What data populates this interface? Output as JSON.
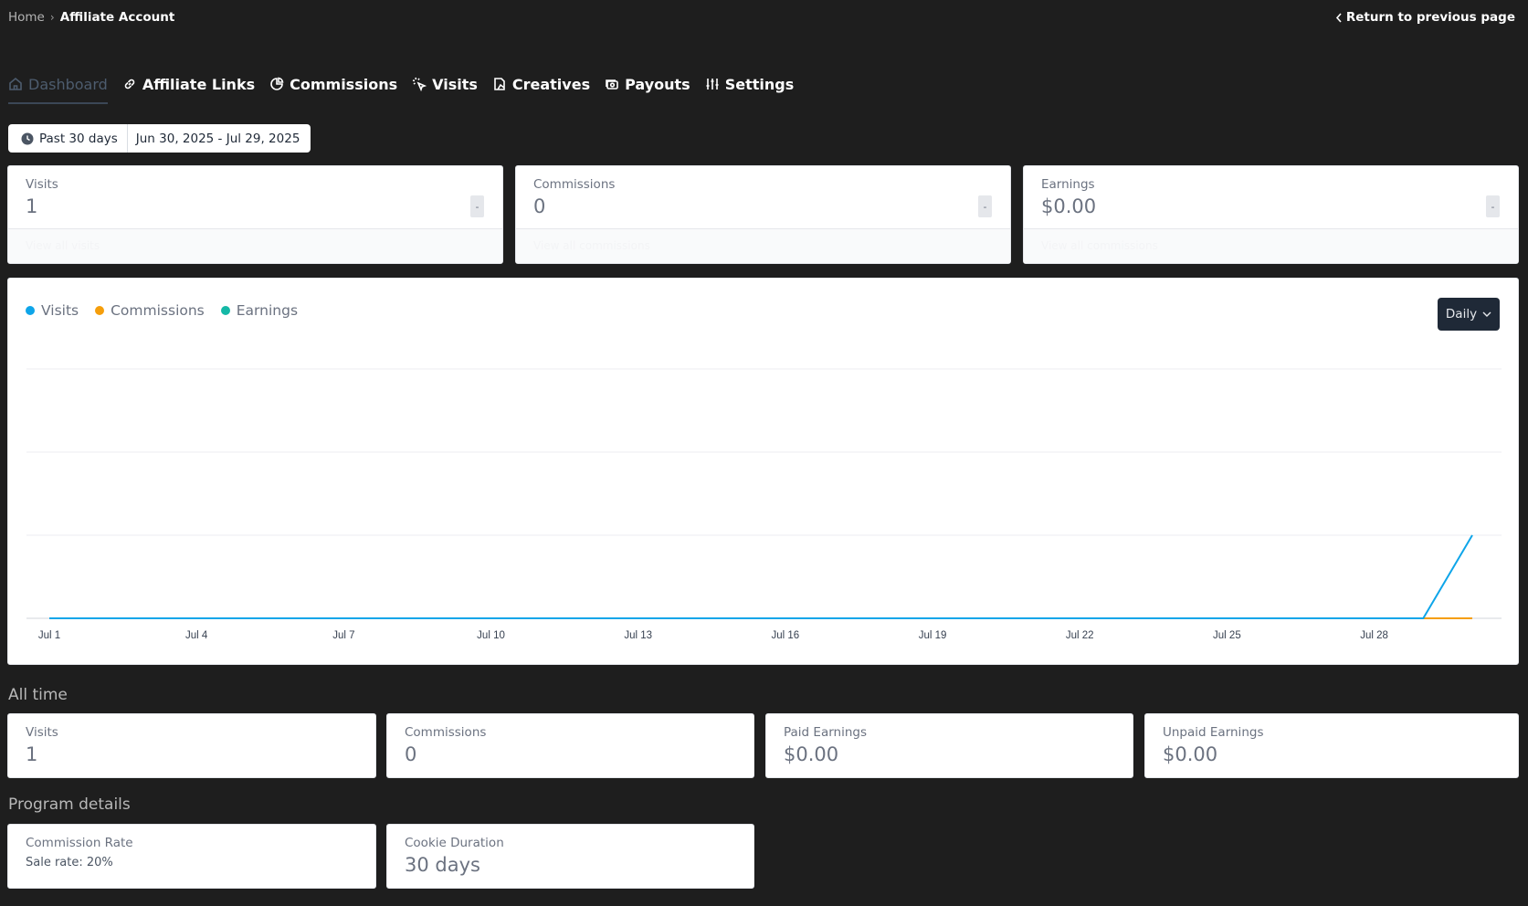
{
  "breadcrumb": {
    "home": "Home",
    "separator": "›",
    "current": "Affiliate Account"
  },
  "return_link": {
    "label": "Return to previous page",
    "icon": "chevron-left-icon"
  },
  "tabs": [
    {
      "label": "Dashboard",
      "icon": "home-icon",
      "active": true
    },
    {
      "label": "Affiliate Links",
      "icon": "link-icon",
      "active": false
    },
    {
      "label": "Commissions",
      "icon": "pie-chart-icon",
      "active": false
    },
    {
      "label": "Visits",
      "icon": "cursor-click-icon",
      "active": false
    },
    {
      "label": "Creatives",
      "icon": "image-icon",
      "active": false
    },
    {
      "label": "Payouts",
      "icon": "money-icon",
      "active": false
    },
    {
      "label": "Settings",
      "icon": "sliders-icon",
      "active": false
    }
  ],
  "date_range": {
    "preset": "Past 30 days",
    "value": "Jun 30, 2025 - Jul 29, 2025"
  },
  "period_stats": [
    {
      "label": "Visits",
      "value": "1",
      "trend": "-",
      "footer_link": "View all visits"
    },
    {
      "label": "Commissions",
      "value": "0",
      "trend": "-",
      "footer_link": "View all commissions"
    },
    {
      "label": "Earnings",
      "value": "$0.00",
      "trend": "-",
      "footer_link": "View all commissions"
    }
  ],
  "chart": {
    "interval": "Daily",
    "colors": {
      "visits": "#0ea5e9",
      "commissions": "#f59e0b",
      "earnings": "#14b8a6"
    }
  },
  "chart_data": {
    "type": "line",
    "x": [
      "Jul 1",
      "Jul 2",
      "Jul 3",
      "Jul 4",
      "Jul 5",
      "Jul 6",
      "Jul 7",
      "Jul 8",
      "Jul 9",
      "Jul 10",
      "Jul 11",
      "Jul 12",
      "Jul 13",
      "Jul 14",
      "Jul 15",
      "Jul 16",
      "Jul 17",
      "Jul 18",
      "Jul 19",
      "Jul 20",
      "Jul 21",
      "Jul 22",
      "Jul 23",
      "Jul 24",
      "Jul 25",
      "Jul 26",
      "Jul 27",
      "Jul 28",
      "Jul 29",
      "Jul 30"
    ],
    "x_tick_labels": [
      "Jul 1",
      "Jul 4",
      "Jul 7",
      "Jul 10",
      "Jul 13",
      "Jul 16",
      "Jul 19",
      "Jul 22",
      "Jul 25",
      "Jul 28"
    ],
    "series": [
      {
        "name": "Visits",
        "color": "#0ea5e9",
        "values": [
          0,
          0,
          0,
          0,
          0,
          0,
          0,
          0,
          0,
          0,
          0,
          0,
          0,
          0,
          0,
          0,
          0,
          0,
          0,
          0,
          0,
          0,
          0,
          0,
          0,
          0,
          0,
          0,
          0,
          1
        ]
      },
      {
        "name": "Commissions",
        "color": "#f59e0b",
        "values": [
          0,
          0,
          0,
          0,
          0,
          0,
          0,
          0,
          0,
          0,
          0,
          0,
          0,
          0,
          0,
          0,
          0,
          0,
          0,
          0,
          0,
          0,
          0,
          0,
          0,
          0,
          0,
          0,
          0,
          0
        ]
      },
      {
        "name": "Earnings",
        "color": "#14b8a6",
        "values": [
          0,
          0,
          0,
          0,
          0,
          0,
          0,
          0,
          0,
          0,
          0,
          0,
          0,
          0,
          0,
          0,
          0,
          0,
          0,
          0,
          0,
          0,
          0,
          0,
          0,
          0,
          0,
          0,
          0,
          0
        ]
      }
    ],
    "ylim": [
      0,
      3
    ],
    "grid": true,
    "legend": "top-left",
    "title": "",
    "xlabel": "",
    "ylabel": ""
  },
  "all_time": {
    "title": "All time",
    "stats": [
      {
        "label": "Visits",
        "value": "1"
      },
      {
        "label": "Commissions",
        "value": "0"
      },
      {
        "label": "Paid Earnings",
        "value": "$0.00"
      },
      {
        "label": "Unpaid Earnings",
        "value": "$0.00"
      }
    ]
  },
  "program_details": {
    "title": "Program details",
    "commission_rate": {
      "label": "Commission Rate",
      "value": "Sale rate: 20%"
    },
    "cookie_duration": {
      "label": "Cookie Duration",
      "value": "30 days"
    }
  }
}
